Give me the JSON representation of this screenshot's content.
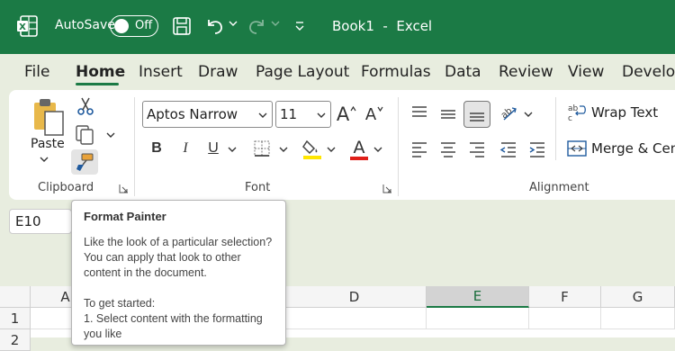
{
  "titlebar": {
    "autosave_label": "AutoSave",
    "toggle_label": "Off",
    "title": "Book1  -  Excel",
    "bg_color": "#1b7a45"
  },
  "menu": {
    "tabs": [
      "File",
      "Home",
      "Insert",
      "Draw",
      "Page Layout",
      "Formulas",
      "Data",
      "Review",
      "View",
      "Develop"
    ],
    "active": "Home"
  },
  "ribbon": {
    "clipboard": {
      "paste_label": "Paste",
      "group_label": "Clipboard"
    },
    "font": {
      "font_name": "Aptos Narrow",
      "font_size": "11",
      "bold": "B",
      "italic": "I",
      "underline": "U",
      "grow": "A",
      "shrink": "A",
      "font_color_letter": "A",
      "group_label": "Font"
    },
    "alignment": {
      "wrap_text": "Wrap Text",
      "merge_center": "Merge & Cent",
      "group_label": "Alignment"
    }
  },
  "namebox": {
    "value": "E10"
  },
  "tooltip": {
    "title": "Format Painter",
    "body": "Like the look of a particular selection? You can apply that look to other content in the document.\n\nTo get started:\n1. Select content with the formatting you like"
  },
  "grid": {
    "columns": [
      "A",
      "D",
      "E",
      "F",
      "G"
    ],
    "rows": [
      "1",
      "2"
    ],
    "selected_column": "E"
  }
}
